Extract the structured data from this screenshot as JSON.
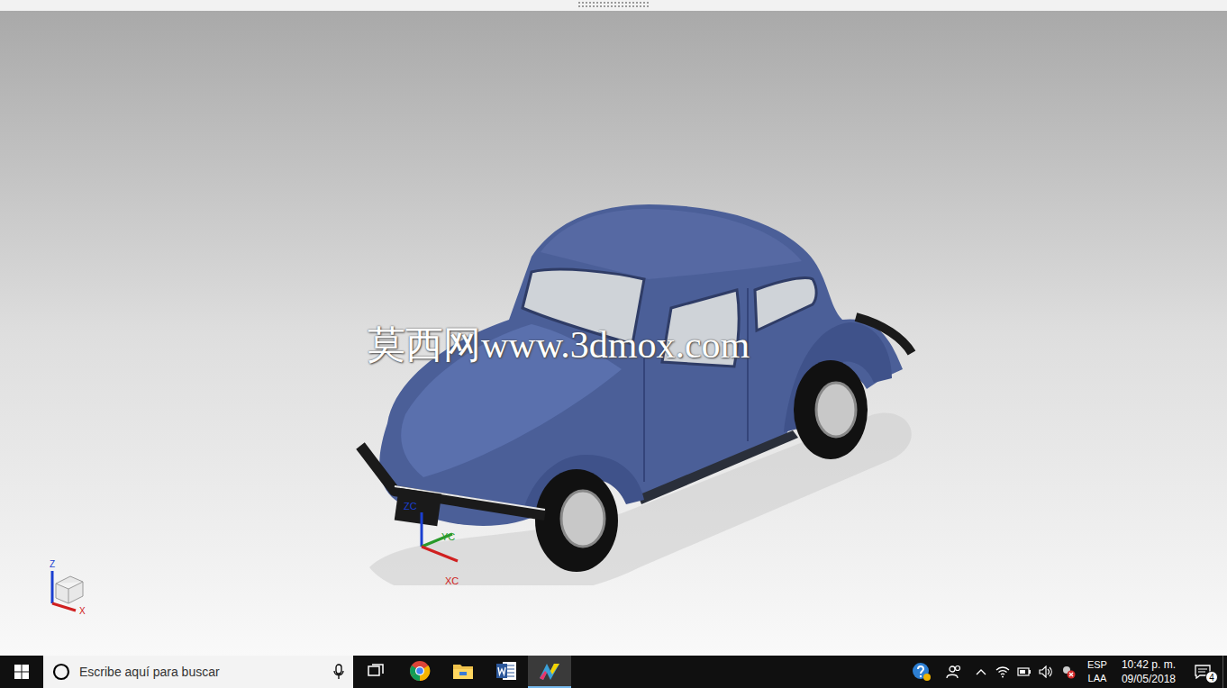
{
  "watermark": "莫西网www.3dmox.com",
  "viewport": {
    "axes": [
      {
        "label": "ZC",
        "color": "#1a3fd0"
      },
      {
        "label": "YC",
        "color": "#2a9a2a"
      },
      {
        "label": "XC",
        "color": "#d02020"
      }
    ],
    "orientation": [
      {
        "label": "Z",
        "color": "#1a3fd0"
      },
      {
        "label": "X",
        "color": "#d02020"
      }
    ]
  },
  "taskbar": {
    "search": {
      "placeholder": "Escribe aquí para buscar"
    },
    "apps": [
      {
        "kind": "taskview",
        "selected": false
      },
      {
        "kind": "chrome",
        "selected": false
      },
      {
        "kind": "explorer",
        "selected": false
      },
      {
        "kind": "word",
        "selected": false
      },
      {
        "kind": "nx",
        "selected": true
      }
    ],
    "tray": {
      "language": "ESP",
      "region": "LAA",
      "time": "10:42 p. m.",
      "date": "09/05/2018",
      "notifications": "4"
    }
  }
}
